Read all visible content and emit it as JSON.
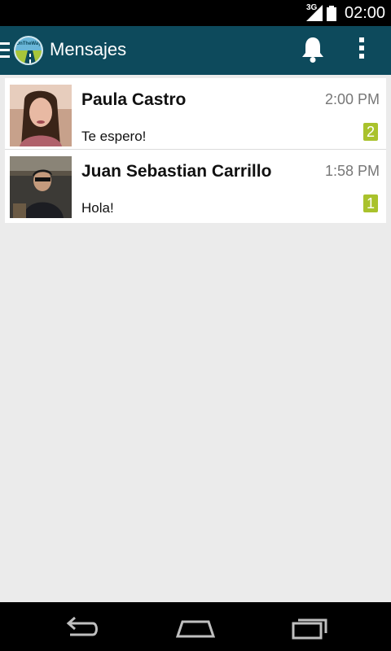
{
  "status_bar": {
    "network": "3G",
    "clock": "02:00"
  },
  "action_bar": {
    "title": "Mensajes",
    "logo_text": "OnTheWay"
  },
  "conversations": [
    {
      "name": "Paula Castro",
      "time": "2:00 PM",
      "preview": "Te espero!",
      "unread": "2"
    },
    {
      "name": "Juan Sebastian Carrillo",
      "time": "1:58 PM",
      "preview": "Hola!",
      "unread": "1"
    }
  ],
  "colors": {
    "action_bar": "#0d4a5c",
    "badge": "#a9c22c",
    "background": "#ebebeb"
  },
  "icons": {
    "drawer": "menu-icon",
    "notifications": "bell-icon",
    "more": "overflow-menu-icon",
    "back": "back-icon",
    "home": "home-icon",
    "recents": "recent-apps-icon"
  }
}
